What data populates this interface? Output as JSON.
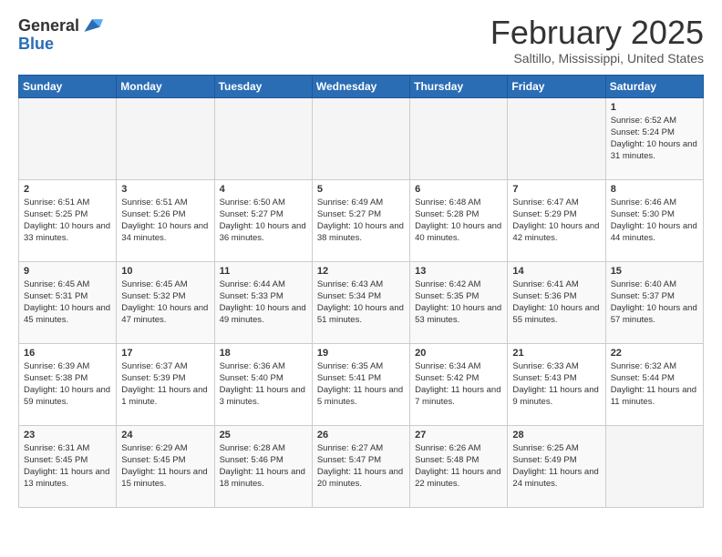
{
  "header": {
    "logo_general": "General",
    "logo_blue": "Blue",
    "title": "February 2025",
    "subtitle": "Saltillo, Mississippi, United States"
  },
  "weekdays": [
    "Sunday",
    "Monday",
    "Tuesday",
    "Wednesday",
    "Thursday",
    "Friday",
    "Saturday"
  ],
  "weeks": [
    [
      {
        "day": "",
        "info": ""
      },
      {
        "day": "",
        "info": ""
      },
      {
        "day": "",
        "info": ""
      },
      {
        "day": "",
        "info": ""
      },
      {
        "day": "",
        "info": ""
      },
      {
        "day": "",
        "info": ""
      },
      {
        "day": "1",
        "info": "Sunrise: 6:52 AM\nSunset: 5:24 PM\nDaylight: 10 hours and 31 minutes."
      }
    ],
    [
      {
        "day": "2",
        "info": "Sunrise: 6:51 AM\nSunset: 5:25 PM\nDaylight: 10 hours and 33 minutes."
      },
      {
        "day": "3",
        "info": "Sunrise: 6:51 AM\nSunset: 5:26 PM\nDaylight: 10 hours and 34 minutes."
      },
      {
        "day": "4",
        "info": "Sunrise: 6:50 AM\nSunset: 5:27 PM\nDaylight: 10 hours and 36 minutes."
      },
      {
        "day": "5",
        "info": "Sunrise: 6:49 AM\nSunset: 5:27 PM\nDaylight: 10 hours and 38 minutes."
      },
      {
        "day": "6",
        "info": "Sunrise: 6:48 AM\nSunset: 5:28 PM\nDaylight: 10 hours and 40 minutes."
      },
      {
        "day": "7",
        "info": "Sunrise: 6:47 AM\nSunset: 5:29 PM\nDaylight: 10 hours and 42 minutes."
      },
      {
        "day": "8",
        "info": "Sunrise: 6:46 AM\nSunset: 5:30 PM\nDaylight: 10 hours and 44 minutes."
      }
    ],
    [
      {
        "day": "9",
        "info": "Sunrise: 6:45 AM\nSunset: 5:31 PM\nDaylight: 10 hours and 45 minutes."
      },
      {
        "day": "10",
        "info": "Sunrise: 6:45 AM\nSunset: 5:32 PM\nDaylight: 10 hours and 47 minutes."
      },
      {
        "day": "11",
        "info": "Sunrise: 6:44 AM\nSunset: 5:33 PM\nDaylight: 10 hours and 49 minutes."
      },
      {
        "day": "12",
        "info": "Sunrise: 6:43 AM\nSunset: 5:34 PM\nDaylight: 10 hours and 51 minutes."
      },
      {
        "day": "13",
        "info": "Sunrise: 6:42 AM\nSunset: 5:35 PM\nDaylight: 10 hours and 53 minutes."
      },
      {
        "day": "14",
        "info": "Sunrise: 6:41 AM\nSunset: 5:36 PM\nDaylight: 10 hours and 55 minutes."
      },
      {
        "day": "15",
        "info": "Sunrise: 6:40 AM\nSunset: 5:37 PM\nDaylight: 10 hours and 57 minutes."
      }
    ],
    [
      {
        "day": "16",
        "info": "Sunrise: 6:39 AM\nSunset: 5:38 PM\nDaylight: 10 hours and 59 minutes."
      },
      {
        "day": "17",
        "info": "Sunrise: 6:37 AM\nSunset: 5:39 PM\nDaylight: 11 hours and 1 minute."
      },
      {
        "day": "18",
        "info": "Sunrise: 6:36 AM\nSunset: 5:40 PM\nDaylight: 11 hours and 3 minutes."
      },
      {
        "day": "19",
        "info": "Sunrise: 6:35 AM\nSunset: 5:41 PM\nDaylight: 11 hours and 5 minutes."
      },
      {
        "day": "20",
        "info": "Sunrise: 6:34 AM\nSunset: 5:42 PM\nDaylight: 11 hours and 7 minutes."
      },
      {
        "day": "21",
        "info": "Sunrise: 6:33 AM\nSunset: 5:43 PM\nDaylight: 11 hours and 9 minutes."
      },
      {
        "day": "22",
        "info": "Sunrise: 6:32 AM\nSunset: 5:44 PM\nDaylight: 11 hours and 11 minutes."
      }
    ],
    [
      {
        "day": "23",
        "info": "Sunrise: 6:31 AM\nSunset: 5:45 PM\nDaylight: 11 hours and 13 minutes."
      },
      {
        "day": "24",
        "info": "Sunrise: 6:29 AM\nSunset: 5:45 PM\nDaylight: 11 hours and 15 minutes."
      },
      {
        "day": "25",
        "info": "Sunrise: 6:28 AM\nSunset: 5:46 PM\nDaylight: 11 hours and 18 minutes."
      },
      {
        "day": "26",
        "info": "Sunrise: 6:27 AM\nSunset: 5:47 PM\nDaylight: 11 hours and 20 minutes."
      },
      {
        "day": "27",
        "info": "Sunrise: 6:26 AM\nSunset: 5:48 PM\nDaylight: 11 hours and 22 minutes."
      },
      {
        "day": "28",
        "info": "Sunrise: 6:25 AM\nSunset: 5:49 PM\nDaylight: 11 hours and 24 minutes."
      },
      {
        "day": "",
        "info": ""
      }
    ]
  ]
}
